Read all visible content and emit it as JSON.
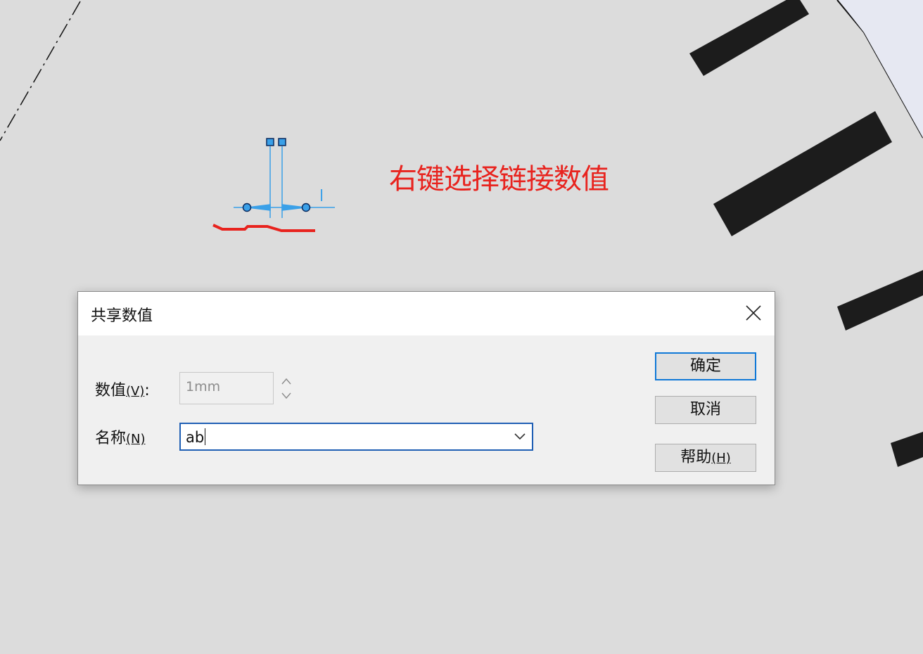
{
  "annotation": {
    "text": "右键选择链接数值",
    "color": "#e8231e"
  },
  "dimension": {
    "label": "l"
  },
  "dialog": {
    "title": "共享数值",
    "close_icon": "close-icon",
    "value_label": "数值",
    "value_hotkey": "(V)",
    "value_suffix": ":",
    "value": "1mm",
    "name_label": "名称",
    "name_hotkey": "(N)",
    "name_value": "ab",
    "ok_label": "确定",
    "cancel_label": "取消",
    "help_label": "帮助",
    "help_hotkey": "(H)"
  },
  "colors": {
    "background": "#dcdcdc",
    "accent": "#1f5fb4",
    "sketch_blue": "#3aa0e8",
    "annotation_red": "#e8231e"
  }
}
